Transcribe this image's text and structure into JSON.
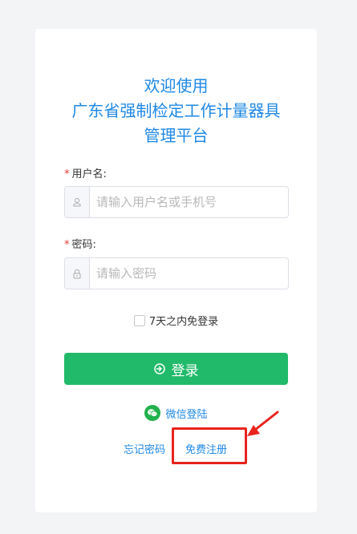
{
  "title": {
    "line1": "欢迎使用",
    "line2": "广东省强制检定工作计量器具",
    "line3": "管理平台"
  },
  "username": {
    "required_mark": "*",
    "label": "用户名:",
    "placeholder": "请输入用户名或手机号",
    "value": ""
  },
  "password": {
    "required_mark": "*",
    "label": "密码:",
    "placeholder": "请输入密码",
    "value": ""
  },
  "remember": {
    "label": "7天之内免登录",
    "checked": false
  },
  "login_button": {
    "label": "登录"
  },
  "wechat_login": {
    "label": "微信登陆"
  },
  "links": {
    "forgot_password": "忘记密码",
    "register": "免费注册"
  },
  "colors": {
    "primary": "#1e88e5",
    "login_button": "#21ba6a",
    "required": "#e53935",
    "annotation": "#e8231d",
    "wechat": "#22b14c"
  }
}
